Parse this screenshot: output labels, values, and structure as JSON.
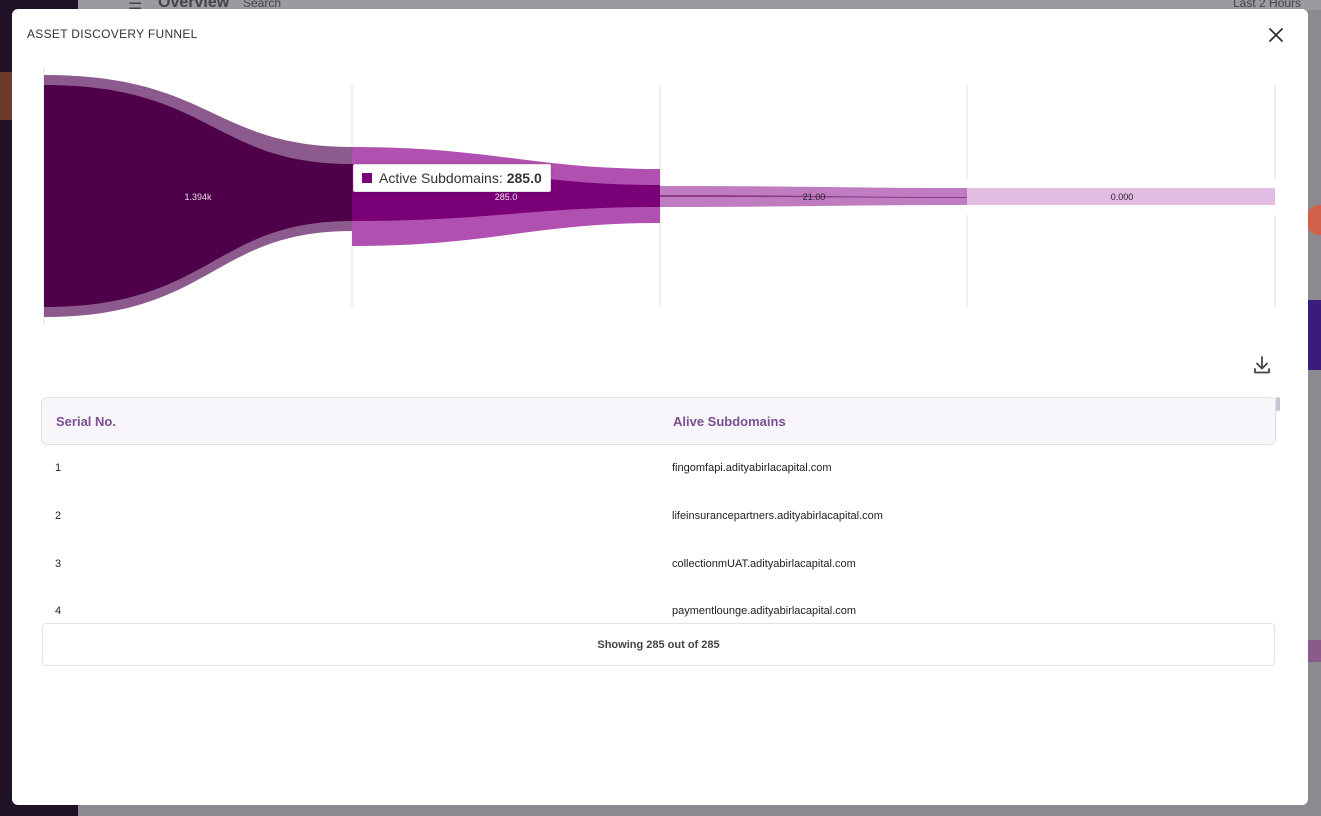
{
  "background": {
    "app_title": "Overview",
    "search_placeholder": "Search",
    "time_range": "Last 2 Hours"
  },
  "modal": {
    "title": "ASSET DISCOVERY FUNNEL",
    "close_icon": "close-icon",
    "download_icon": "download-icon"
  },
  "chart_data": {
    "type": "funnel",
    "stages": [
      {
        "value": 1394,
        "label": "1.394k",
        "color": "#4e0049"
      },
      {
        "value": 285,
        "label": "285.0",
        "color": "#7a0077"
      },
      {
        "value": 21,
        "label": "21.00",
        "color": "#c07cc0"
      },
      {
        "value": 0,
        "label": "0.000",
        "color": "#e3bde3"
      }
    ],
    "tooltip": {
      "series": "Active Subdomains",
      "value": "285.0"
    }
  },
  "table": {
    "headers": [
      "Serial No.",
      "Alive Subdomains"
    ],
    "rows": [
      {
        "serial": "1",
        "subdomain": "fingomfapi.adityabirlacapital.com"
      },
      {
        "serial": "2",
        "subdomain": "lifeinsurancepartners.adityabirlacapital.com"
      },
      {
        "serial": "3",
        "subdomain": "collectionmUAT.adityabirlacapital.com"
      },
      {
        "serial": "4",
        "subdomain": "paymentlounge.adityabirlacapital.com"
      }
    ],
    "footer": "Showing 285 out of 285"
  }
}
